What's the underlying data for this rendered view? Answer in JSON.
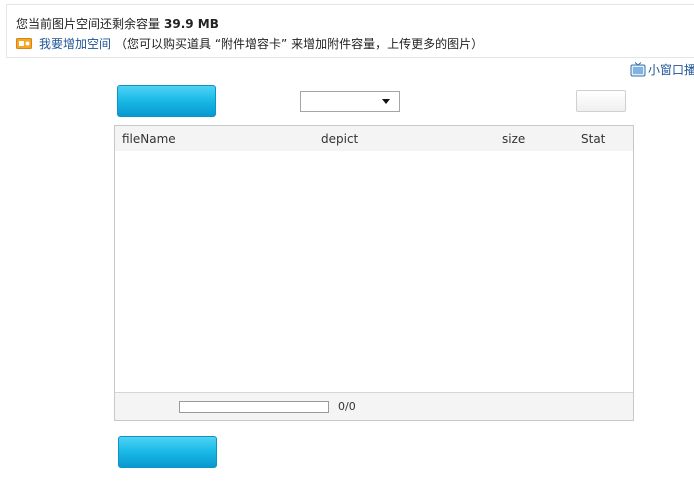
{
  "quota": {
    "label": "您当前图片空间还剩余容量",
    "amount": "39.9 MB"
  },
  "add_space": {
    "icon": "coupon-icon",
    "link_text": "我要增加空间",
    "note": "（您可以购买道具 “附件增容卡” 来增加附件容量，上传更多的图片）"
  },
  "mini_player": {
    "icon": "tv-icon",
    "label": "小窗口播"
  },
  "toolbar": {
    "top_upload_label": "",
    "select_value": "",
    "right_button_label": ""
  },
  "table": {
    "columns": [
      "fileName",
      "depict",
      "size",
      "Stat"
    ],
    "rows": []
  },
  "footer": {
    "progress": 0,
    "progress_text": "0/0"
  },
  "bottom_button_label": "",
  "colors": {
    "accent": "#19b8e6",
    "link": "#1e5494",
    "header_bg": "#f4f4f4"
  }
}
